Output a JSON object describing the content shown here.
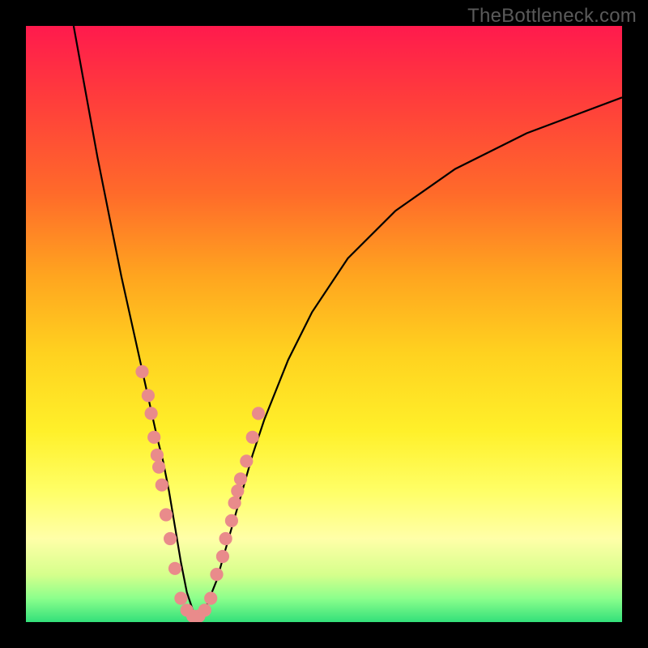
{
  "watermark": "TheBottleneck.com",
  "background": {
    "frame_color": "#000000",
    "gradient_stops": [
      {
        "pos": 0,
        "color": "#ff1a4d"
      },
      {
        "pos": 12,
        "color": "#ff3c3c"
      },
      {
        "pos": 28,
        "color": "#ff6a2a"
      },
      {
        "pos": 42,
        "color": "#ffa51f"
      },
      {
        "pos": 55,
        "color": "#ffd21f"
      },
      {
        "pos": 68,
        "color": "#fff02a"
      },
      {
        "pos": 78,
        "color": "#ffff66"
      },
      {
        "pos": 86,
        "color": "#ffffa8"
      },
      {
        "pos": 92,
        "color": "#d6ff8c"
      },
      {
        "pos": 96,
        "color": "#8cff8c"
      },
      {
        "pos": 100,
        "color": "#33e07a"
      }
    ]
  },
  "chart_data": {
    "type": "line",
    "title": "",
    "xlabel": "",
    "ylabel": "",
    "xlim": [
      0,
      100
    ],
    "ylim": [
      0,
      100
    ],
    "grid": false,
    "legend": false,
    "series": [
      {
        "name": "bottleneck-curve",
        "color": "#000000",
        "x": [
          8,
          10,
          12,
          14,
          16,
          18,
          20,
          22,
          23,
          24,
          25,
          26,
          27,
          28,
          29,
          30,
          32,
          34,
          36,
          38,
          40,
          44,
          48,
          54,
          62,
          72,
          84,
          100
        ],
        "y": [
          100,
          89,
          78,
          68,
          58,
          49,
          40,
          31,
          27,
          22,
          16,
          10,
          5,
          2,
          1,
          2,
          7,
          14,
          21,
          28,
          34,
          44,
          52,
          61,
          69,
          76,
          82,
          88
        ]
      }
    ],
    "scatter_overlay": {
      "name": "sample-points",
      "color": "#e98b8b",
      "radius_percent": 1.1,
      "points": [
        {
          "x": 19.5,
          "y": 42
        },
        {
          "x": 20.5,
          "y": 38
        },
        {
          "x": 21.0,
          "y": 35
        },
        {
          "x": 21.5,
          "y": 31
        },
        {
          "x": 22.0,
          "y": 28
        },
        {
          "x": 22.3,
          "y": 26
        },
        {
          "x": 22.8,
          "y": 23
        },
        {
          "x": 23.5,
          "y": 18
        },
        {
          "x": 24.2,
          "y": 14
        },
        {
          "x": 25.0,
          "y": 9
        },
        {
          "x": 26.0,
          "y": 4
        },
        {
          "x": 27.0,
          "y": 2
        },
        {
          "x": 28.0,
          "y": 1
        },
        {
          "x": 29.0,
          "y": 1
        },
        {
          "x": 30.0,
          "y": 2
        },
        {
          "x": 31.0,
          "y": 4
        },
        {
          "x": 32.0,
          "y": 8
        },
        {
          "x": 33.0,
          "y": 11
        },
        {
          "x": 33.5,
          "y": 14
        },
        {
          "x": 34.5,
          "y": 17
        },
        {
          "x": 35.0,
          "y": 20
        },
        {
          "x": 35.5,
          "y": 22
        },
        {
          "x": 36.0,
          "y": 24
        },
        {
          "x": 37.0,
          "y": 27
        },
        {
          "x": 38.0,
          "y": 31
        },
        {
          "x": 39.0,
          "y": 35
        }
      ]
    }
  }
}
